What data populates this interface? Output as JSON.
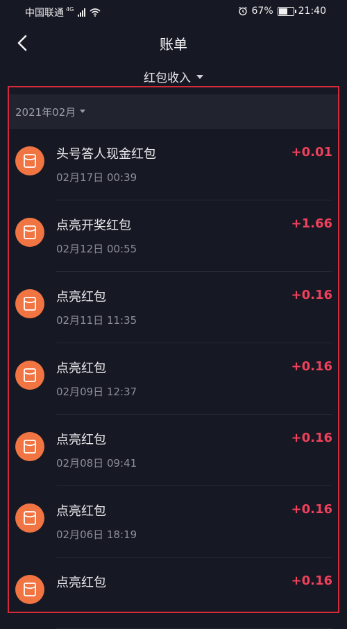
{
  "status_bar": {
    "carrier": "中国联通",
    "network": "4G",
    "battery": "67%",
    "battery_level": 0.67,
    "time": "21:40"
  },
  "header": {
    "title": "账单"
  },
  "filter": {
    "label": "红包收入"
  },
  "month": {
    "label": "2021年02月"
  },
  "transactions": [
    {
      "title": "头号答人现金红包",
      "time": "02月17日 00:39",
      "amount": "+0.01"
    },
    {
      "title": "点亮开奖红包",
      "time": "02月12日 00:55",
      "amount": "+1.66"
    },
    {
      "title": "点亮红包",
      "time": "02月11日 11:35",
      "amount": "+0.16"
    },
    {
      "title": "点亮红包",
      "time": "02月09日 12:37",
      "amount": "+0.16"
    },
    {
      "title": "点亮红包",
      "time": "02月08日 09:41",
      "amount": "+0.16"
    },
    {
      "title": "点亮红包",
      "time": "02月06日 18:19",
      "amount": "+0.16"
    },
    {
      "title": "点亮红包",
      "time": "",
      "amount": "+0.16"
    }
  ],
  "colors": {
    "background": "#161823",
    "amount": "#f0415c",
    "icon": "#f07543",
    "highlight_frame": "#d42a3a"
  },
  "icons": {
    "back": "chevron-left-icon",
    "filter_dropdown": "caret-down-icon",
    "transaction": "red-packet-icon"
  }
}
